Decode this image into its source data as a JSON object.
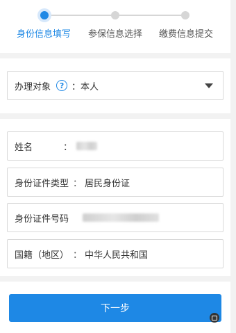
{
  "stepper": {
    "steps": [
      {
        "label": "身份信息填写",
        "active": true
      },
      {
        "label": "参保信息选择",
        "active": false
      },
      {
        "label": "缴费信息提交",
        "active": false
      }
    ]
  },
  "target": {
    "label": "办理对象",
    "help_icon": "?",
    "colon": "：",
    "value": "本人"
  },
  "form": {
    "name_label": "姓名",
    "colon": "：",
    "id_type_label": "身份证件类型",
    "id_type_value": "居民身份证",
    "id_number_label": "身份证件号码",
    "nation_label": "国籍（地区）",
    "nation_value": "中华人民共和国"
  },
  "actions": {
    "next_label": "下一步"
  },
  "colors": {
    "accent": "#1e88e5",
    "inactive": "#d6d6d6"
  }
}
